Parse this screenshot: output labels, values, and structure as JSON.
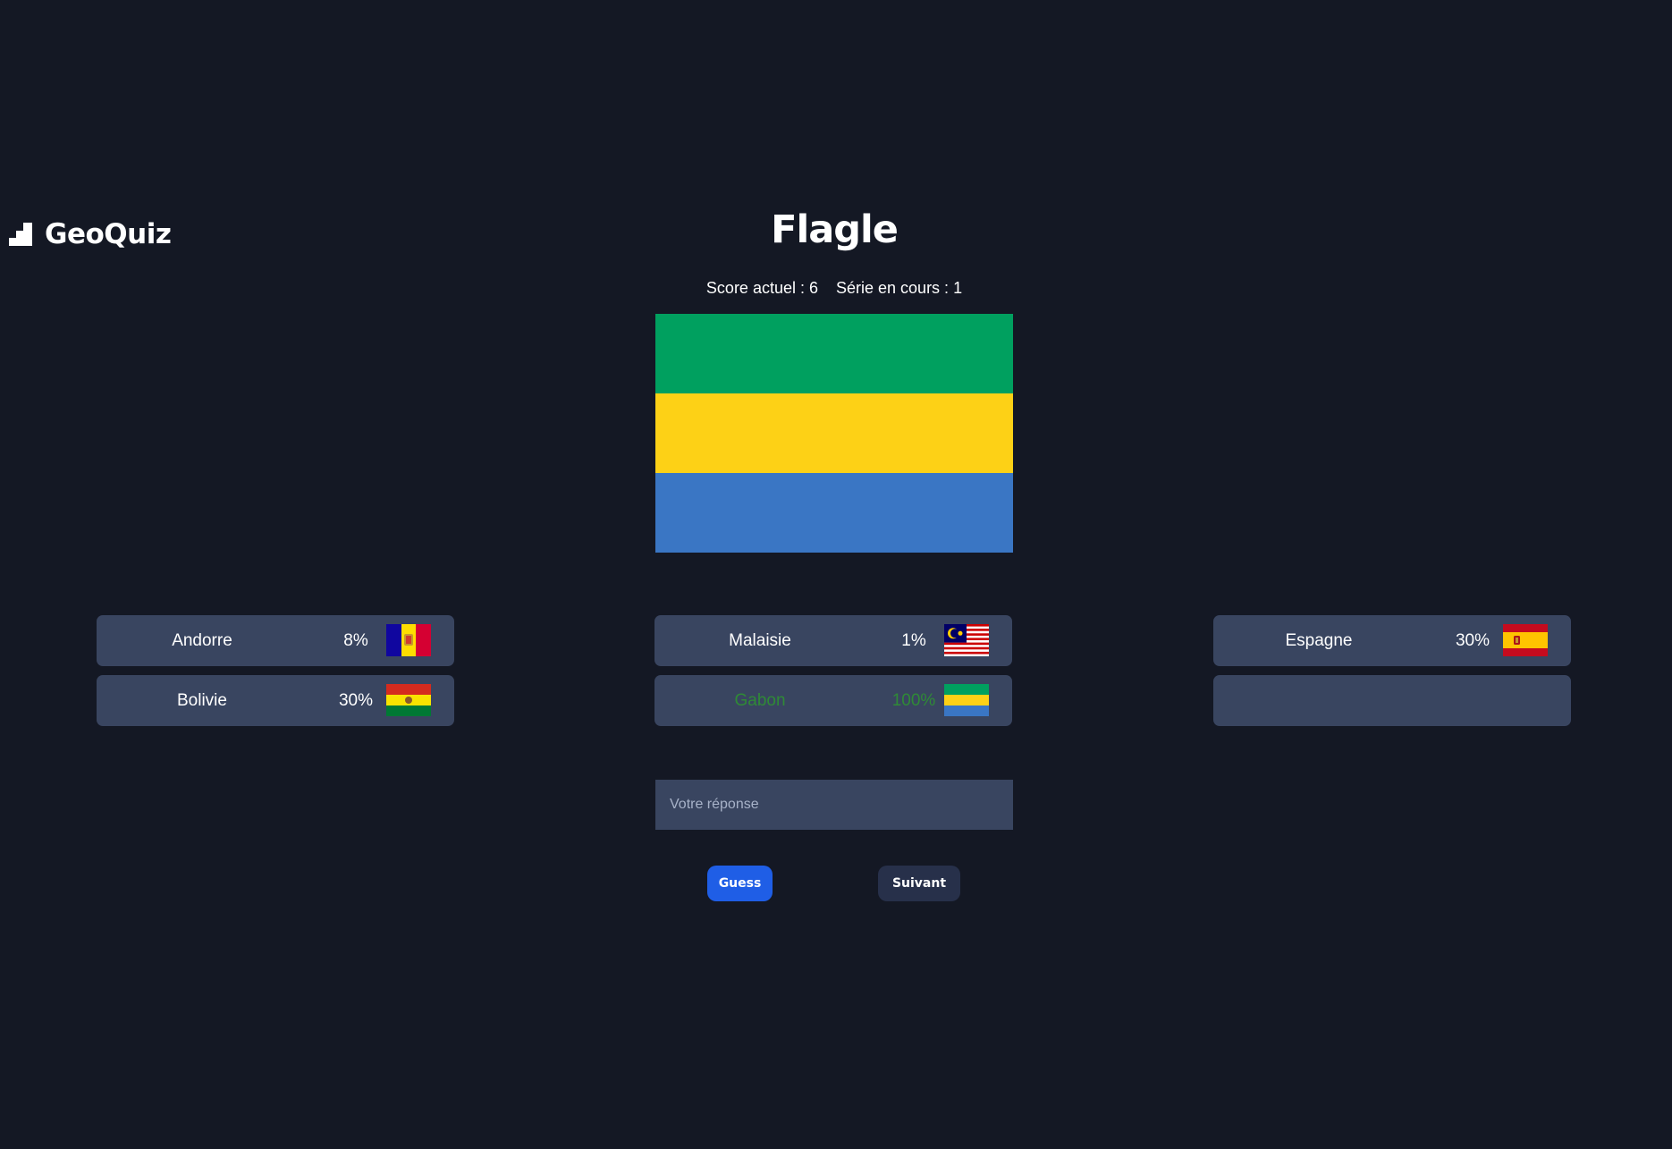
{
  "app": {
    "name": "GeoQuiz",
    "logo_icon": "stairs-icon"
  },
  "game": {
    "title": "Flagle",
    "score_label": "Score actuel : 6",
    "streak_label": "Série en cours : 1"
  },
  "target_flag": {
    "icon": "gabon-flag",
    "bands": [
      "#00a05f",
      "#fdd116",
      "#3a76c4"
    ]
  },
  "guesses": [
    {
      "country": "Andorre",
      "percent": "8%",
      "flag": "andorra-flag",
      "correct": false
    },
    {
      "country": "Malaisie",
      "percent": "1%",
      "flag": "malaysia-flag",
      "correct": false
    },
    {
      "country": "Espagne",
      "percent": "30%",
      "flag": "spain-flag",
      "correct": false
    },
    {
      "country": "Bolivie",
      "percent": "30%",
      "flag": "bolivia-flag",
      "correct": false
    },
    {
      "country": "Gabon",
      "percent": "100%",
      "flag": "gabon-flag",
      "correct": true
    }
  ],
  "empty_slots": 1,
  "input": {
    "placeholder": "Votre réponse",
    "value": ""
  },
  "buttons": {
    "guess_label": "Guess",
    "next_label": "Suivant"
  },
  "colors": {
    "background": "#141824",
    "panel": "#394560",
    "correct_text": "#2f8a36",
    "primary_button": "#1f5ee6",
    "secondary_button": "#27304a"
  }
}
